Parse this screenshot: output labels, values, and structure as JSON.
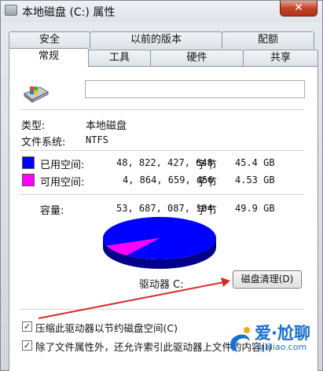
{
  "window": {
    "title": "本地磁盘 (C:) 属性",
    "close_label": "✕"
  },
  "tabs_row1": [
    "安全",
    "以前的版本",
    "配额"
  ],
  "tabs_row2": [
    "常规",
    "工具",
    "硬件",
    "共享"
  ],
  "general": {
    "name_value": "",
    "type_label": "类型:",
    "type_value": "本地磁盘",
    "fs_label": "文件系统:",
    "fs_value": "NTFS",
    "used_label": "已用空间:",
    "used_bytes": "48, 822, 427, 648",
    "used_unit": "字节",
    "used_size": "45.4 GB",
    "free_label": "可用空间:",
    "free_bytes": "4, 864, 659, 456",
    "free_unit": "字节",
    "free_size": "4.53 GB",
    "capacity_label": "容量:",
    "capacity_bytes": "53, 687, 087, 104",
    "capacity_unit": "字节",
    "capacity_size": "49.9 GB",
    "drive_label": "驱动器 C:",
    "cleanup_button": "磁盘清理(D)",
    "compress_label": "压缩此驱动器以节约磁盘空间(C)",
    "compress_checked": true,
    "index_label": "除了文件属性外，还允许索引此驱动器上文件的内容(I)",
    "index_checked": true,
    "used_fraction": 0.909,
    "colors": {
      "used": "#0000ff",
      "free": "#ff00ff"
    }
  },
  "watermark": {
    "text": "爱·尬聊",
    "url": "igaliao.com"
  }
}
